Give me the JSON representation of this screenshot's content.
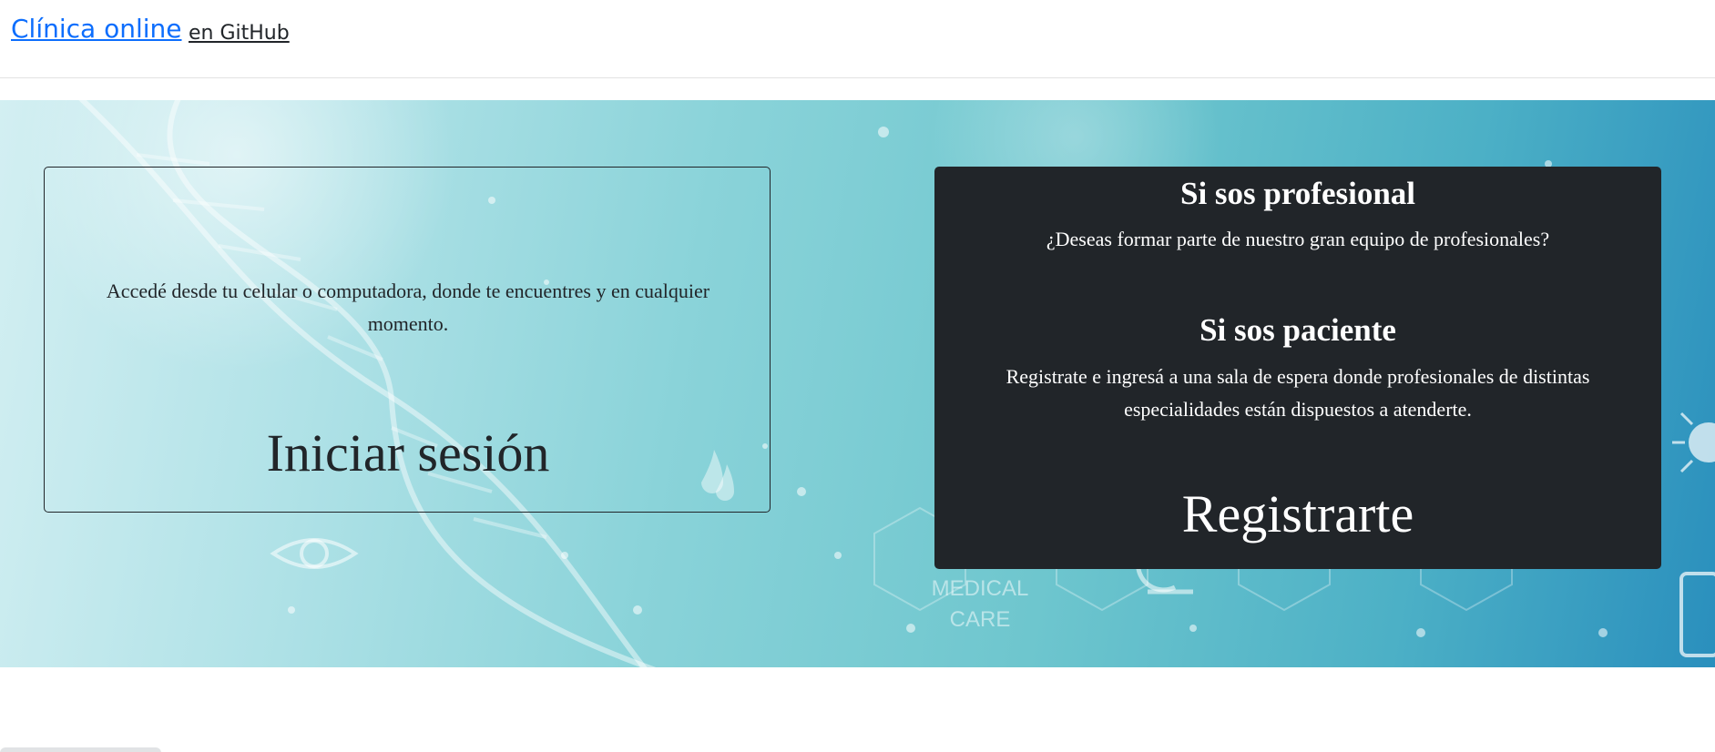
{
  "header": {
    "brand": "Clínica online",
    "github_link": "en GitHub"
  },
  "hero": {
    "art_labels": [
      "MEDICAL",
      "CARE"
    ],
    "login_card": {
      "description": "Accedé desde tu celular o computadora, donde te encuentres y en cualquier momento.",
      "button_label": "Iniciar sesión"
    },
    "register_card": {
      "professional_title": "Si sos profesional",
      "professional_text": "¿Deseas formar parte de nuestro gran equipo de profesionales?",
      "patient_title": "Si sos paciente",
      "patient_text": "Registrate e ingresá a una sala de espera donde profesionales de distintas especialidades están dispuestos a atenderte.",
      "button_label": "Registrarte"
    }
  },
  "colors": {
    "link": "#0d6efd",
    "dark_card": "#212529",
    "text_dark": "#212529"
  }
}
